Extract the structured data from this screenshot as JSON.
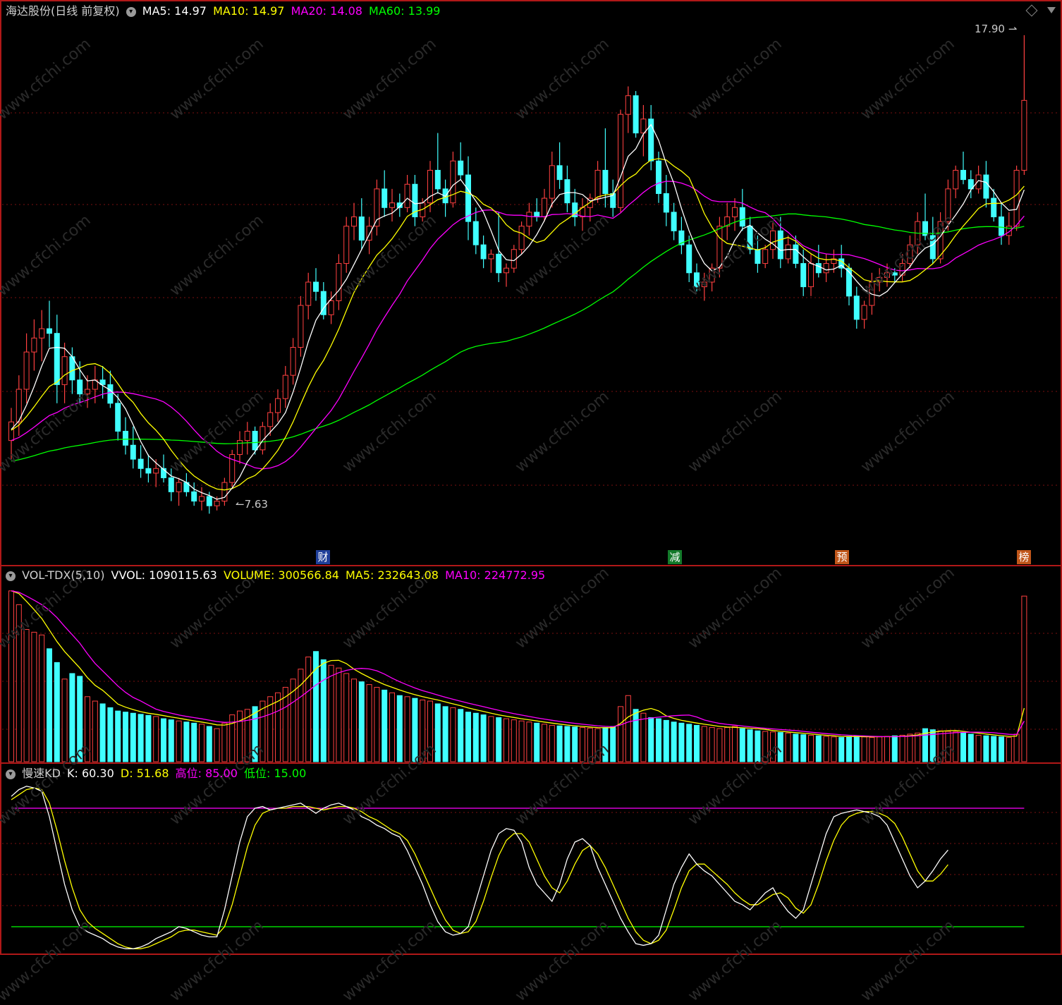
{
  "header": {
    "title": "海达股份(日线 前复权)",
    "ma": [
      {
        "label": "MA5: 14.97",
        "color": "#ffffff"
      },
      {
        "label": "MA10: 14.97",
        "color": "#ffff00"
      },
      {
        "label": "MA20: 14.08",
        "color": "#ff00ff"
      },
      {
        "label": "MA60: 13.99",
        "color": "#00ff00"
      }
    ]
  },
  "vol_header": {
    "name": "VOL-TDX(5,10)",
    "vvol": "VVOL: 1090115.63",
    "volume": "VOLUME: 300566.84",
    "ma5": "MA5: 232643.08",
    "ma10": "MA10: 224772.95"
  },
  "kd_header": {
    "name": "慢速KD",
    "k": "K: 60.30",
    "d": "D: 51.68",
    "high": "高位: 85.00",
    "low": "低位: 15.00"
  },
  "annotations": {
    "high": "17.90",
    "low": "7.63"
  },
  "events": [
    {
      "label": "财",
      "bg": "#1f3f9a"
    },
    {
      "label": "减",
      "bg": "#137a2a"
    },
    {
      "label": "预",
      "bg": "#c0561a"
    },
    {
      "label": "榜",
      "bg": "#c0561a"
    }
  ],
  "watermark": "www.cfchi.com",
  "colors": {
    "up": "#ff4040",
    "down": "#40ffff",
    "ma5": "#ffffff",
    "ma10": "#ffff00",
    "ma20": "#ff00ff",
    "ma60": "#00ff00",
    "border": "#b01818",
    "grid": "#7a1010"
  },
  "chart_data": [
    {
      "type": "candlestick",
      "title": "海达股份(日线 前复权)",
      "ylim": [
        7.0,
        18.2
      ],
      "ohlc": [
        [
          9.2,
          9.9,
          8.8,
          9.6
        ],
        [
          9.6,
          10.6,
          9.3,
          10.3
        ],
        [
          10.3,
          11.5,
          10.0,
          11.1
        ],
        [
          11.1,
          11.8,
          10.7,
          11.4
        ],
        [
          11.4,
          12.0,
          10.9,
          11.6
        ],
        [
          11.6,
          12.2,
          11.2,
          11.5
        ],
        [
          11.5,
          11.9,
          10.0,
          10.4
        ],
        [
          10.4,
          11.3,
          10.0,
          11.0
        ],
        [
          11.0,
          11.2,
          10.2,
          10.5
        ],
        [
          10.5,
          10.9,
          10.0,
          10.2
        ],
        [
          10.2,
          10.6,
          9.9,
          10.3
        ],
        [
          10.3,
          10.8,
          10.0,
          10.5
        ],
        [
          10.5,
          10.8,
          10.1,
          10.4
        ],
        [
          10.4,
          10.7,
          9.9,
          10.0
        ],
        [
          10.0,
          10.2,
          9.2,
          9.4
        ],
        [
          9.4,
          9.7,
          8.9,
          9.1
        ],
        [
          9.1,
          9.5,
          8.6,
          8.8
        ],
        [
          8.8,
          9.1,
          8.4,
          8.6
        ],
        [
          8.6,
          8.9,
          8.3,
          8.5
        ],
        [
          8.5,
          8.8,
          8.2,
          8.6
        ],
        [
          8.6,
          8.9,
          8.3,
          8.4
        ],
        [
          8.4,
          8.6,
          7.9,
          8.1
        ],
        [
          8.1,
          8.4,
          7.8,
          8.3
        ],
        [
          8.3,
          8.5,
          8.0,
          8.1
        ],
        [
          8.1,
          8.3,
          7.8,
          7.9
        ],
        [
          7.9,
          8.2,
          7.7,
          8.0
        ],
        [
          8.0,
          8.1,
          7.63,
          7.8
        ],
        [
          7.8,
          8.0,
          7.7,
          7.9
        ],
        [
          7.9,
          8.4,
          7.8,
          8.3
        ],
        [
          8.3,
          9.0,
          8.2,
          8.9
        ],
        [
          8.9,
          9.4,
          8.7,
          9.2
        ],
        [
          9.2,
          9.6,
          8.9,
          9.4
        ],
        [
          9.4,
          9.5,
          8.9,
          9.0
        ],
        [
          9.0,
          9.6,
          8.9,
          9.5
        ],
        [
          9.5,
          10.0,
          9.3,
          9.8
        ],
        [
          9.8,
          10.3,
          9.6,
          10.1
        ],
        [
          10.1,
          10.8,
          9.9,
          10.6
        ],
        [
          10.6,
          11.4,
          10.4,
          11.2
        ],
        [
          11.2,
          12.3,
          11.0,
          12.1
        ],
        [
          12.1,
          12.8,
          11.8,
          12.6
        ],
        [
          12.6,
          12.9,
          12.2,
          12.4
        ],
        [
          12.4,
          12.6,
          11.8,
          11.9
        ],
        [
          11.9,
          12.4,
          11.7,
          12.2
        ],
        [
          12.2,
          13.2,
          12.0,
          13.0
        ],
        [
          13.0,
          14.0,
          12.8,
          13.8
        ],
        [
          13.8,
          14.3,
          13.5,
          14.0
        ],
        [
          14.0,
          14.4,
          13.3,
          13.5
        ],
        [
          13.5,
          14.0,
          13.2,
          13.8
        ],
        [
          13.8,
          14.8,
          13.6,
          14.6
        ],
        [
          14.6,
          15.0,
          14.0,
          14.2
        ],
        [
          14.2,
          14.6,
          13.9,
          14.3
        ],
        [
          14.3,
          14.5,
          14.0,
          14.2
        ],
        [
          14.2,
          14.9,
          14.1,
          14.7
        ],
        [
          14.7,
          14.9,
          13.8,
          14.0
        ],
        [
          14.0,
          14.4,
          13.9,
          14.3
        ],
        [
          14.3,
          15.2,
          14.1,
          15.0
        ],
        [
          15.0,
          15.8,
          14.5,
          14.6
        ],
        [
          14.6,
          14.8,
          14.0,
          14.3
        ],
        [
          14.3,
          15.4,
          14.2,
          15.2
        ],
        [
          15.2,
          15.6,
          14.8,
          14.9
        ],
        [
          14.9,
          15.3,
          13.5,
          13.9
        ],
        [
          13.9,
          14.2,
          13.2,
          13.4
        ],
        [
          13.4,
          13.6,
          12.9,
          13.1
        ],
        [
          13.1,
          13.3,
          12.8,
          13.2
        ],
        [
          13.2,
          14.1,
          12.6,
          12.8
        ],
        [
          12.8,
          13.0,
          12.5,
          12.9
        ],
        [
          12.9,
          13.4,
          12.8,
          13.3
        ],
        [
          13.3,
          13.9,
          13.2,
          13.8
        ],
        [
          13.8,
          14.3,
          13.6,
          14.1
        ],
        [
          14.1,
          14.4,
          13.9,
          14.0
        ],
        [
          14.0,
          14.6,
          13.9,
          14.4
        ],
        [
          14.4,
          15.4,
          14.2,
          15.1
        ],
        [
          15.1,
          15.6,
          14.6,
          14.8
        ],
        [
          14.8,
          15.1,
          14.1,
          14.3
        ],
        [
          14.3,
          14.6,
          13.8,
          14.0
        ],
        [
          14.0,
          14.4,
          13.7,
          14.2
        ],
        [
          14.2,
          14.5,
          13.9,
          14.4
        ],
        [
          14.4,
          15.2,
          14.3,
          15.0
        ],
        [
          15.0,
          15.9,
          14.2,
          14.5
        ],
        [
          14.5,
          14.8,
          14.0,
          14.2
        ],
        [
          14.2,
          16.3,
          14.1,
          16.2
        ],
        [
          16.2,
          16.8,
          15.8,
          16.6
        ],
        [
          16.6,
          16.7,
          15.7,
          15.8
        ],
        [
          15.8,
          16.4,
          15.3,
          16.1
        ],
        [
          16.1,
          16.4,
          15.0,
          15.2
        ],
        [
          15.2,
          15.4,
          14.3,
          14.5
        ],
        [
          14.5,
          14.9,
          13.8,
          14.1
        ],
        [
          14.1,
          14.3,
          13.5,
          13.7
        ],
        [
          13.7,
          14.0,
          13.2,
          13.4
        ],
        [
          13.4,
          13.6,
          12.6,
          12.8
        ],
        [
          12.8,
          13.0,
          12.4,
          12.5
        ],
        [
          12.5,
          12.8,
          12.2,
          12.6
        ],
        [
          12.6,
          13.0,
          12.4,
          12.9
        ],
        [
          12.9,
          14.0,
          12.7,
          13.8
        ],
        [
          13.8,
          14.3,
          13.5,
          14.0
        ],
        [
          14.0,
          14.4,
          13.7,
          14.2
        ],
        [
          14.2,
          14.6,
          13.7,
          13.8
        ],
        [
          13.8,
          14.0,
          13.2,
          13.3
        ],
        [
          13.3,
          13.6,
          12.8,
          13.0
        ],
        [
          13.0,
          13.4,
          12.9,
          13.3
        ],
        [
          13.3,
          13.9,
          13.1,
          13.7
        ],
        [
          13.7,
          14.0,
          12.9,
          13.1
        ],
        [
          13.1,
          13.6,
          13.0,
          13.4
        ],
        [
          13.4,
          13.6,
          12.9,
          13.0
        ],
        [
          13.0,
          13.3,
          12.3,
          12.5
        ],
        [
          12.5,
          13.2,
          12.3,
          13.0
        ],
        [
          13.0,
          13.4,
          12.7,
          12.8
        ],
        [
          12.8,
          13.2,
          12.6,
          13.0
        ],
        [
          13.0,
          13.3,
          12.8,
          13.1
        ],
        [
          13.1,
          13.4,
          12.7,
          12.9
        ],
        [
          12.9,
          13.0,
          12.1,
          12.3
        ],
        [
          12.3,
          12.5,
          11.6,
          11.8
        ],
        [
          11.8,
          12.2,
          11.6,
          12.1
        ],
        [
          12.1,
          12.8,
          11.9,
          12.6
        ],
        [
          12.6,
          12.9,
          12.4,
          12.7
        ],
        [
          12.7,
          13.0,
          12.5,
          12.8
        ],
        [
          12.8,
          12.9,
          12.6,
          12.75
        ],
        [
          12.75,
          13.2,
          12.6,
          13.0
        ],
        [
          13.0,
          13.6,
          12.9,
          13.4
        ],
        [
          13.4,
          14.1,
          13.2,
          13.9
        ],
        [
          13.9,
          14.5,
          13.5,
          13.6
        ],
        [
          13.6,
          14.0,
          13.0,
          13.1
        ],
        [
          13.1,
          14.1,
          13.0,
          13.9
        ],
        [
          13.9,
          14.8,
          13.7,
          14.6
        ],
        [
          14.6,
          15.1,
          14.4,
          15.0
        ],
        [
          15.0,
          15.4,
          14.7,
          14.8
        ],
        [
          14.8,
          15.0,
          14.4,
          14.6
        ],
        [
          14.6,
          15.1,
          14.5,
          14.9
        ],
        [
          14.9,
          15.2,
          14.2,
          14.4
        ],
        [
          14.4,
          14.6,
          13.9,
          14.0
        ],
        [
          14.0,
          14.3,
          13.4,
          13.6
        ],
        [
          13.6,
          14.1,
          13.4,
          13.8
        ],
        [
          13.8,
          15.1,
          13.7,
          15.0
        ],
        [
          15.0,
          17.9,
          14.9,
          16.5
        ]
      ],
      "indicators": [
        "MA5",
        "MA10",
        "MA20",
        "MA60"
      ],
      "last_values": {
        "MA5": 14.97,
        "MA10": 14.97,
        "MA20": 14.08,
        "MA60": 13.99
      },
      "extremes": {
        "high": 17.9,
        "low": 7.63
      }
    },
    {
      "type": "bar",
      "title": "VOL-TDX(5,10)",
      "ylim": [
        0,
        320000
      ],
      "values": [
        310000,
        285000,
        240000,
        235000,
        230000,
        205000,
        180000,
        150000,
        160000,
        155000,
        118000,
        110000,
        105000,
        98000,
        92000,
        90000,
        88000,
        86000,
        84000,
        82000,
        78000,
        76000,
        74000,
        72000,
        70000,
        68000,
        64000,
        60000,
        70000,
        85000,
        92000,
        95000,
        100000,
        110000,
        118000,
        125000,
        135000,
        150000,
        168000,
        190000,
        200000,
        185000,
        175000,
        170000,
        160000,
        150000,
        145000,
        140000,
        135000,
        130000,
        125000,
        120000,
        118000,
        115000,
        112000,
        110000,
        105000,
        100000,
        98000,
        95000,
        90000,
        88000,
        85000,
        82000,
        80000,
        78000,
        76000,
        74000,
        72000,
        70000,
        68000,
        66000,
        65000,
        64000,
        63000,
        62000,
        61000,
        60000,
        62000,
        64000,
        100000,
        120000,
        95000,
        88000,
        80000,
        78000,
        75000,
        72000,
        70000,
        68000,
        66000,
        64000,
        62000,
        60000,
        62000,
        64000,
        60000,
        58000,
        56000,
        55000,
        54000,
        53000,
        52000,
        50000,
        49000,
        48000,
        47000,
        46000,
        45000,
        44000,
        46000,
        47000,
        45000,
        44000,
        45000,
        46000,
        47000,
        48000,
        50000,
        52000,
        60000,
        58000,
        56000,
        55000,
        54000,
        52000,
        50000,
        48000,
        47000,
        46000,
        45000,
        44000,
        50000,
        300566.84
      ],
      "last_values": {
        "VOLUME": 300566.84,
        "MA5": 232643.08,
        "MA10": 224772.95,
        "VVOL": 1090115.63
      }
    },
    {
      "type": "line",
      "title": "慢速KD",
      "ylim": [
        0,
        100
      ],
      "series": [
        {
          "name": "K",
          "values": [
            92,
            96,
            98,
            97,
            95,
            80,
            60,
            40,
            25,
            15,
            12,
            10,
            8,
            5,
            3,
            2,
            2,
            3,
            5,
            8,
            10,
            12,
            15,
            14,
            12,
            10,
            9,
            9,
            25,
            45,
            65,
            80,
            85,
            86,
            84,
            85,
            86,
            87,
            88,
            85,
            82,
            85,
            87,
            88,
            86,
            84,
            80,
            78,
            75,
            73,
            70,
            68,
            60,
            50,
            40,
            28,
            18,
            12,
            10,
            11,
            15,
            30,
            45,
            60,
            70,
            73,
            72,
            65,
            50,
            40,
            35,
            30,
            40,
            55,
            65,
            67,
            63,
            50,
            40,
            30,
            20,
            12,
            5,
            4,
            5,
            10,
            25,
            40,
            50,
            58,
            52,
            48,
            45,
            40,
            35,
            30,
            28,
            25,
            30,
            35,
            38,
            30,
            24,
            20,
            25,
            40,
            55,
            70,
            80,
            82,
            83,
            84,
            83,
            82,
            80,
            75,
            65,
            55,
            45,
            38,
            42,
            48,
            55,
            60.3
          ]
        },
        {
          "name": "D",
          "values": [
            90,
            93,
            96,
            97,
            96,
            88,
            72,
            54,
            38,
            25,
            18,
            14,
            11,
            8,
            5,
            3,
            2,
            2,
            3,
            5,
            7,
            9,
            12,
            13,
            13,
            12,
            11,
            10,
            15,
            28,
            45,
            62,
            75,
            82,
            84,
            85,
            85,
            86,
            86,
            86,
            85,
            84,
            85,
            86,
            86,
            85,
            83,
            80,
            78,
            75,
            72,
            70,
            66,
            58,
            48,
            38,
            28,
            19,
            13,
            11,
            12,
            18,
            30,
            44,
            57,
            66,
            70,
            70,
            65,
            55,
            45,
            38,
            35,
            42,
            52,
            60,
            63,
            58,
            50,
            40,
            30,
            20,
            12,
            7,
            5,
            7,
            13,
            25,
            38,
            48,
            52,
            52,
            48,
            44,
            40,
            35,
            31,
            28,
            28,
            31,
            34,
            35,
            32,
            26,
            23,
            28,
            40,
            54,
            66,
            75,
            80,
            82,
            83,
            83,
            82,
            80,
            76,
            68,
            58,
            48,
            42,
            42,
            46,
            51.68
          ]
        }
      ],
      "reference_lines": {
        "高位": 85.0,
        "低位": 15.0
      }
    }
  ]
}
